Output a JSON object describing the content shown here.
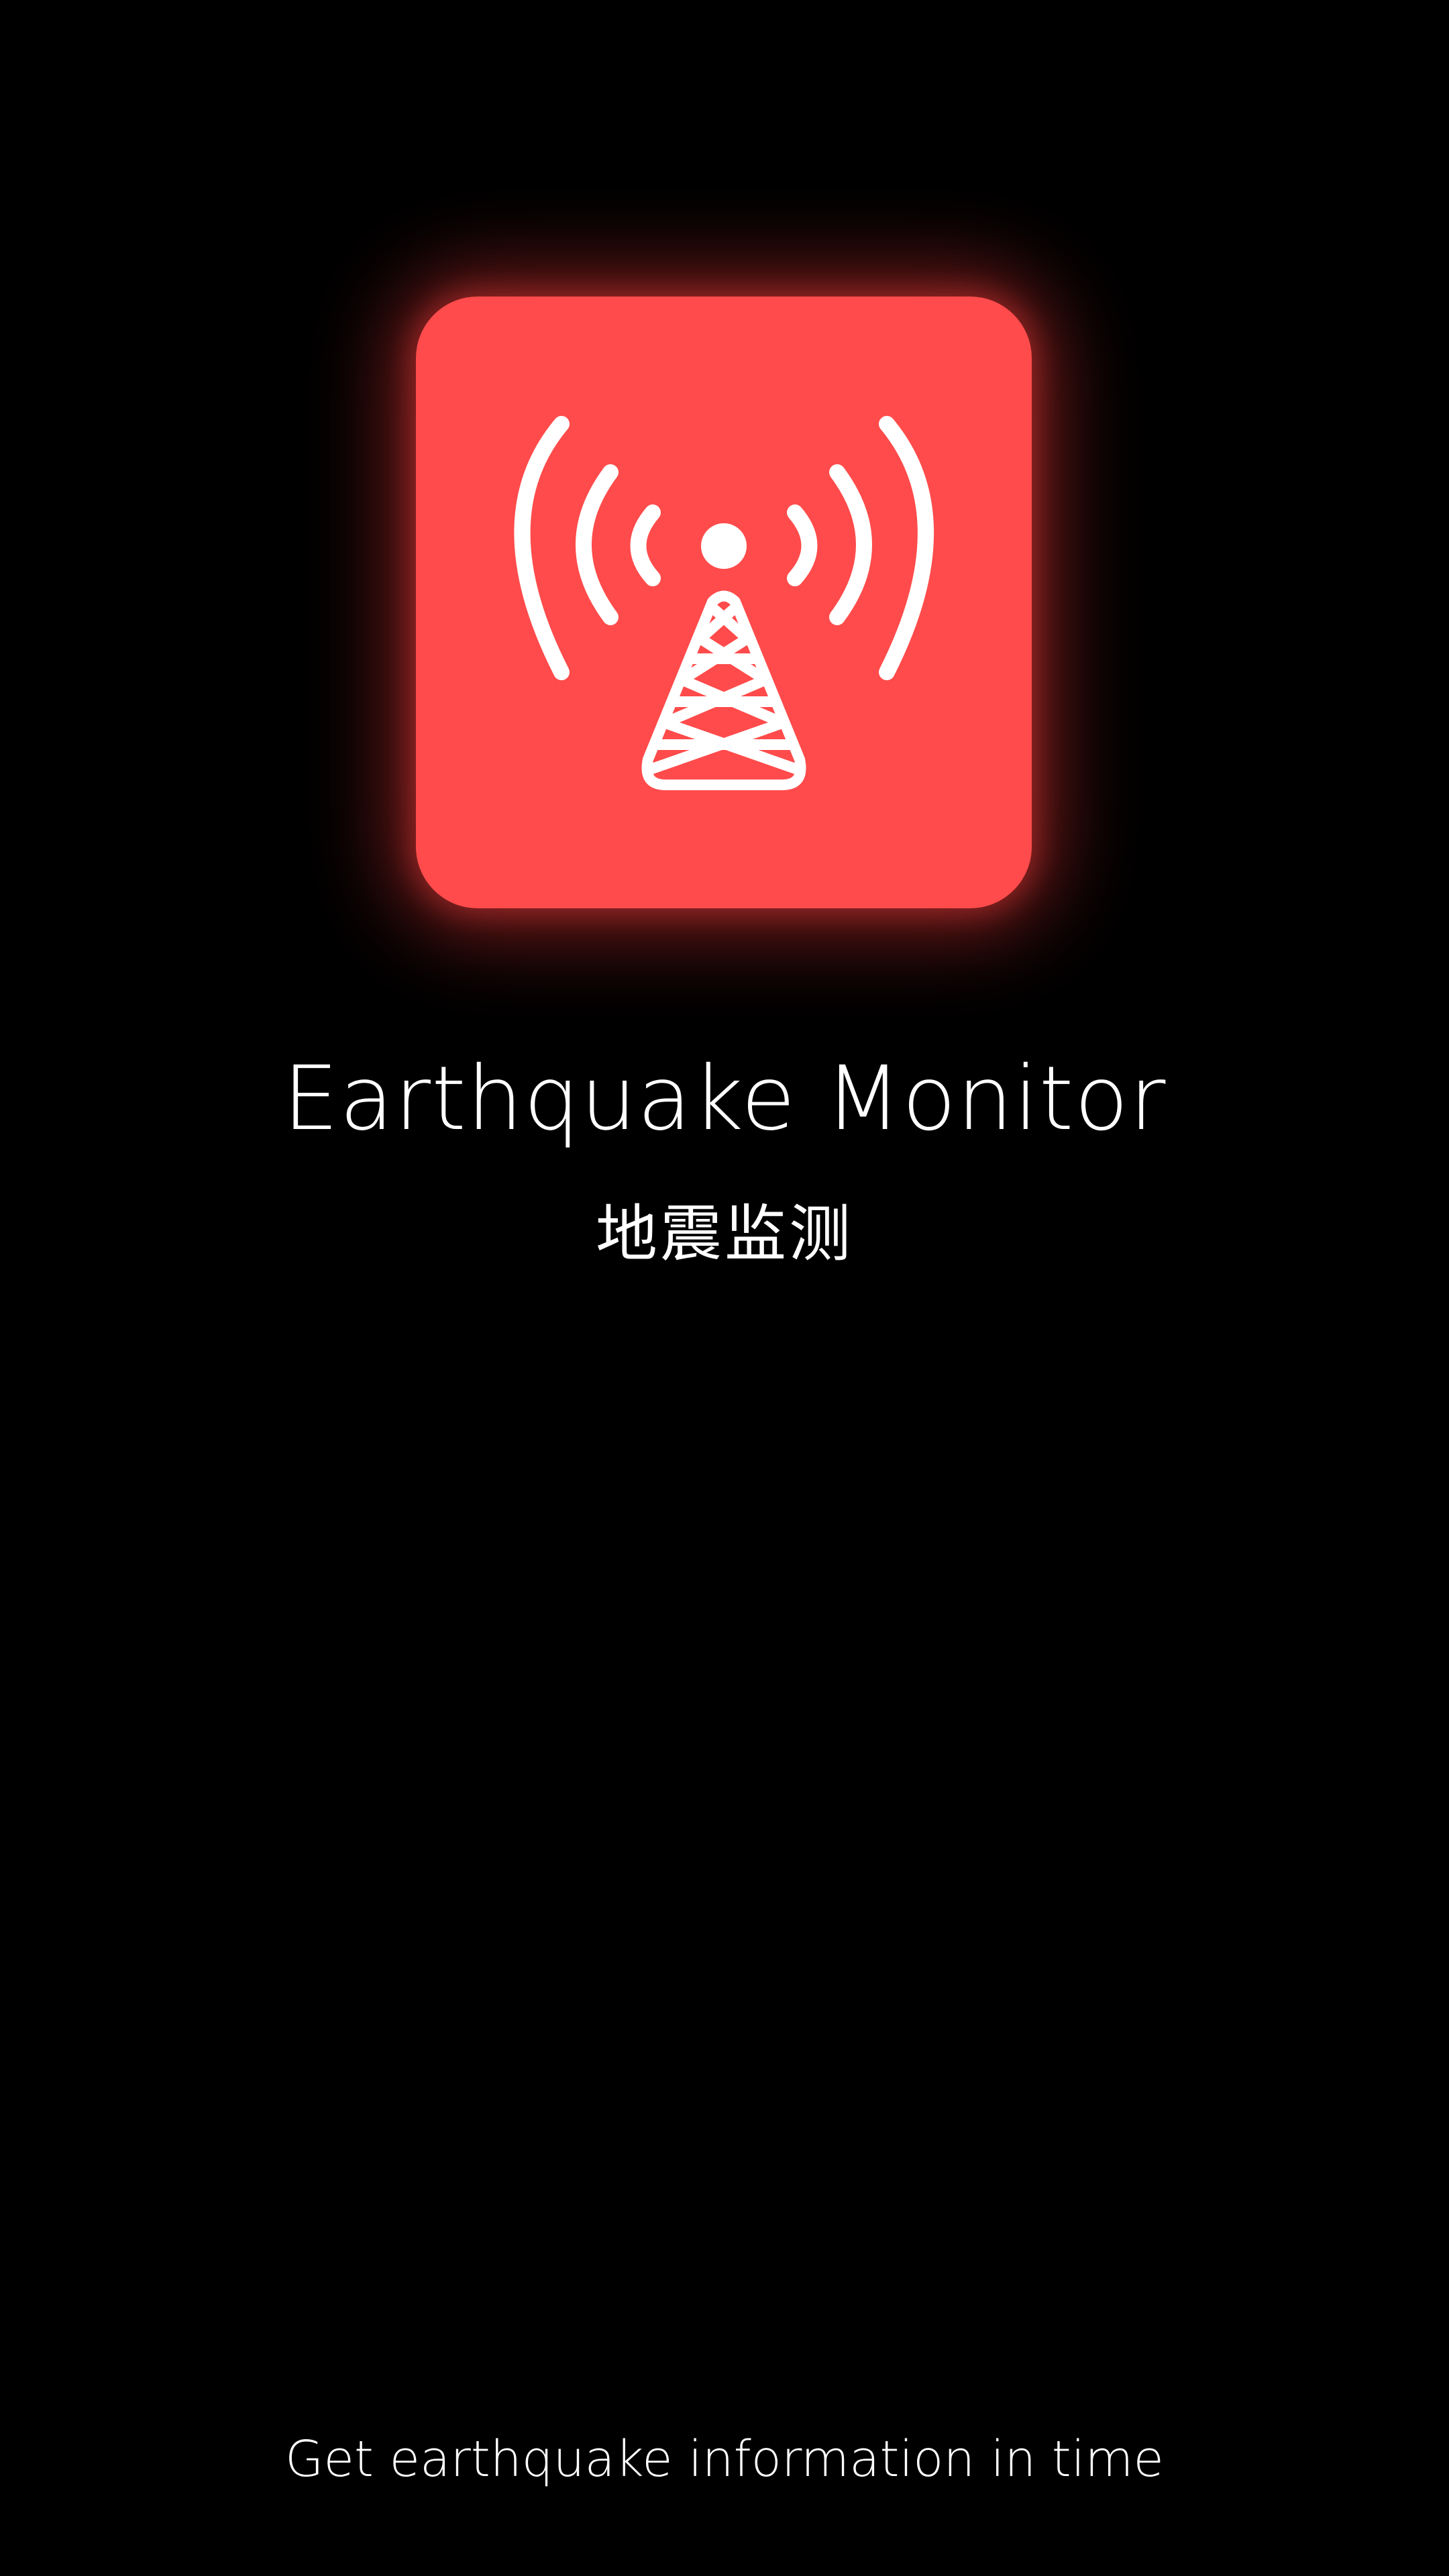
{
  "app": {
    "title": "Earthquake Monitor",
    "subtitle": "地震监测",
    "tagline": "Get earthquake information in time",
    "icon": "broadcast-tower-icon"
  },
  "colors": {
    "background": "#000000",
    "accent": "#ff4b4b",
    "icon_glyph": "#ffffff",
    "text": "#ffffff"
  }
}
